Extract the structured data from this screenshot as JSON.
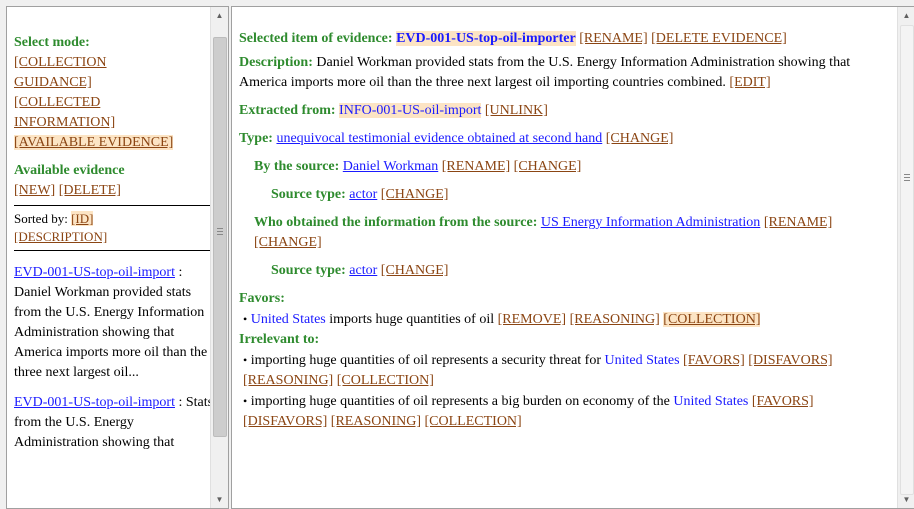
{
  "left": {
    "select_mode_label": "Select mode:",
    "modes": [
      "[COLLECTION",
      "GUIDANCE]",
      "[COLLECTED",
      "INFORMATION]",
      "[AVAILABLE EVIDENCE]"
    ],
    "available_title": "Available evidence",
    "new_label": "[NEW]",
    "delete_label": "[DELETE]",
    "sorted_by_label": "Sorted by:",
    "sort_id": "[ID]",
    "sort_description": "[DESCRIPTION]",
    "items": [
      {
        "id": "EVD-001-US-top-oil-import",
        "text": ": Daniel Workman provided stats from the U.S. Energy Information Administration showing that America imports more oil than the three next largest oil..."
      },
      {
        "id": "EVD-001-US-top-oil-import",
        "text": ": Stats from the U.S. Energy Administration showing that"
      }
    ]
  },
  "right": {
    "selected_label": "Selected item of evidence:",
    "selected_id": "EVD-001-US-top-oil-importer",
    "rename_label": "[RENAME]",
    "delete_evidence_label": "[DELETE EVIDENCE]",
    "description_label": "Description:",
    "description_text": "Daniel Workman provided stats from the U.S. Energy Information Administration showing that America imports more oil than the three next largest oil importing countries combined.",
    "edit_label": "[EDIT]",
    "extracted_label": "Extracted from:",
    "extracted_value": "INFO-001-US-oil-import",
    "unlink_label": "[UNLINK]",
    "type_label": "Type:",
    "type_value": "unequivocal testimonial evidence obtained at second hand",
    "change_label": "[CHANGE]",
    "by_source_label": "By the source:",
    "by_source_value": "Daniel Workman",
    "source_type_label": "Source type:",
    "source_type_value": "actor",
    "who_obtained_label": "Who obtained the information from the source:",
    "who_obtained_value": "US Energy Information Administration",
    "source_type2_value": "actor",
    "favors_label": "Favors:",
    "favors_entity": "United States",
    "favors_text": "imports huge quantities of oil",
    "remove_label": "[REMOVE]",
    "reasoning_label": "[REASONING]",
    "collection_label": "[COLLECTION]",
    "irrelevant_label": "Irrelevant to:",
    "irr1_text": "importing huge quantities of oil represents a security threat for",
    "irr1_entity": "United States",
    "favors_btn": "[FAVORS]",
    "disfavors_btn": "[DISFAVORS]",
    "irr2_text": "importing huge quantities of oil represents a big burden on economy of the",
    "irr2_entity": "United States",
    "bullet": "•"
  },
  "colors": {
    "green": "#2e8b2e",
    "action": "#8b4513",
    "link": "#1a1aff",
    "highlight": "#fce4c4"
  }
}
